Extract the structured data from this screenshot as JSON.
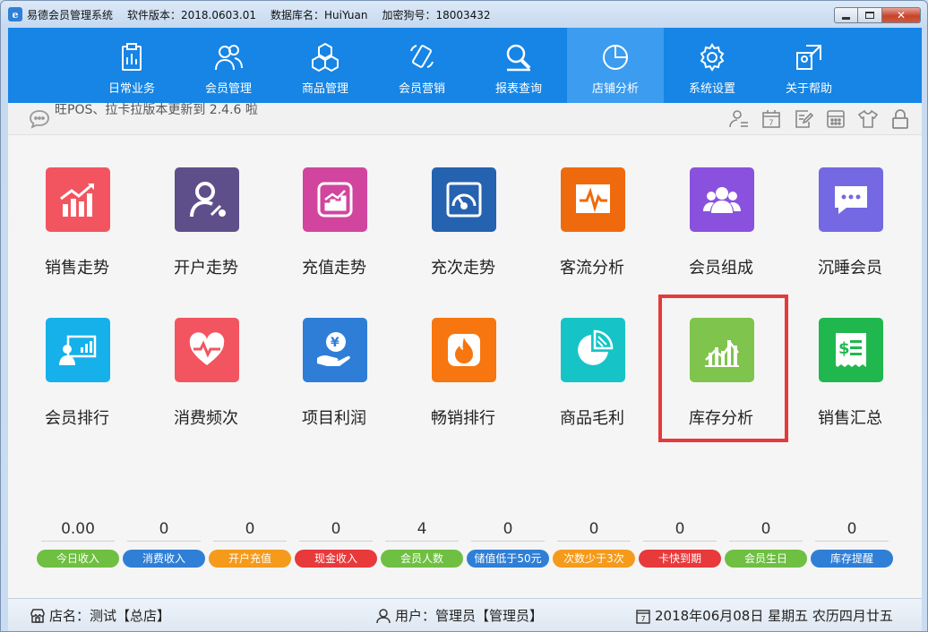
{
  "titlebar": {
    "app_name": "易德会员管理系统",
    "version": "软件版本：2018.0603.01",
    "database": "数据库名：HuiYuan",
    "dongle": "加密狗号：18003432"
  },
  "nav": {
    "items": [
      {
        "label": "日常业务",
        "icon": "clipboard-icon"
      },
      {
        "label": "会员管理",
        "icon": "users-icon"
      },
      {
        "label": "商品管理",
        "icon": "boxes-icon"
      },
      {
        "label": "会员营销",
        "icon": "phone-icon"
      },
      {
        "label": "报表查询",
        "icon": "search-icon"
      },
      {
        "label": "店铺分析",
        "icon": "pie-chart-icon",
        "active": true
      },
      {
        "label": "系统设置",
        "icon": "gear-icon"
      },
      {
        "label": "关于帮助",
        "icon": "help-icon"
      }
    ]
  },
  "notice": {
    "text": "旺POS、拉卡拉版本更新到 2.4.6 啦"
  },
  "grid": {
    "items": [
      {
        "label": "销售走势",
        "color": "#f2555f",
        "icon": "sales-trend-icon"
      },
      {
        "label": "开户走势",
        "color": "#5e4f8a",
        "icon": "account-trend-icon"
      },
      {
        "label": "充值走势",
        "color": "#d1459e",
        "icon": "recharge-trend-icon"
      },
      {
        "label": "充次走势",
        "color": "#2562b0",
        "icon": "gauge-icon"
      },
      {
        "label": "客流分析",
        "color": "#ef6a0c",
        "icon": "pulse-icon"
      },
      {
        "label": "会员组成",
        "color": "#8a51de",
        "icon": "members-icon"
      },
      {
        "label": "沉睡会员",
        "color": "#7469e2",
        "icon": "chat-icon"
      },
      {
        "label": "会员排行",
        "color": "#16b0ea",
        "icon": "presentation-icon"
      },
      {
        "label": "消费频次",
        "color": "#f2555f",
        "icon": "heart-pulse-icon"
      },
      {
        "label": "项目利润",
        "color": "#2e7ed8",
        "icon": "money-hand-icon"
      },
      {
        "label": "畅销排行",
        "color": "#f7760f",
        "icon": "fire-icon"
      },
      {
        "label": "商品毛利",
        "color": "#16c4c7",
        "icon": "pie-icon"
      },
      {
        "label": "库存分析",
        "color": "#7fc44c",
        "icon": "inventory-chart-icon"
      },
      {
        "label": "销售汇总",
        "color": "#20b84e",
        "icon": "receipt-icon"
      }
    ]
  },
  "stats": [
    {
      "value": "0.00",
      "label": "今日收入",
      "color": "#6fbf42"
    },
    {
      "value": "0",
      "label": "消费收入",
      "color": "#2f7fd6"
    },
    {
      "value": "0",
      "label": "开户充值",
      "color": "#f59a1b"
    },
    {
      "value": "0",
      "label": "现金收入",
      "color": "#e8393b"
    },
    {
      "value": "4",
      "label": "会员人数",
      "color": "#6fbf42"
    },
    {
      "value": "0",
      "label": "储值低于50元",
      "color": "#2f7fd6"
    },
    {
      "value": "0",
      "label": "次数少于3次",
      "color": "#f59a1b"
    },
    {
      "value": "0",
      "label": "卡快到期",
      "color": "#e8393b"
    },
    {
      "value": "0",
      "label": "会员生日",
      "color": "#6fbf42"
    },
    {
      "value": "0",
      "label": "库存提醒",
      "color": "#2f7fd6"
    }
  ],
  "statusbar": {
    "shop": "店名：测试【总店】",
    "user": "用户：管理员【管理员】",
    "date": "2018年06月08日 星期五 农历四月廿五"
  }
}
